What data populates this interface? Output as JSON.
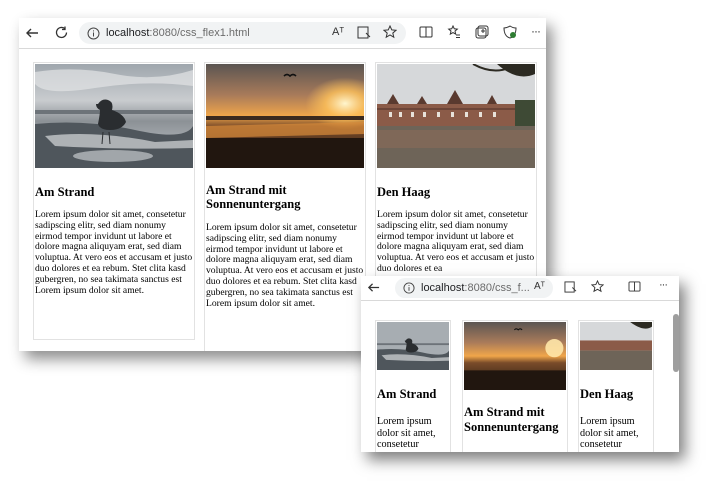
{
  "large_window": {
    "url_host": "localhost",
    "url_rest": ":8080/css_flex1.html",
    "cards": [
      {
        "title": "Am Strand",
        "image": "beach-bird-photo",
        "text": "Lorem ipsum dolor sit amet, consetetur sadipscing elitr, sed diam nonumy eirmod tempor invidunt ut labore et dolore magna aliquyam erat, sed diam voluptua. At vero eos et accusam et justo duo dolores et ea rebum. Stet clita kasd gubergren, no sea takimata sanctus est Lorem ipsum dolor sit amet."
      },
      {
        "title": "Am Strand mit Sonnenuntergang",
        "image": "sunset-beach-photo",
        "text": "Lorem ipsum dolor sit amet, consetetur sadipscing elitr, sed diam nonumy eirmod tempor invidunt ut labore et dolore magna aliquyam erat, sed diam voluptua. At vero eos et accusam et justo duo dolores et ea rebum. Stet clita kasd gubergren, no sea takimata sanctus est Lorem ipsum dolor sit amet."
      },
      {
        "title": "Den Haag",
        "image": "den-haag-photo",
        "text": "Lorem ipsum dolor sit amet, consetetur sadipscing elitr, sed diam nonumy eirmod tempor invidunt ut labore et dolore magna aliquyam erat, sed diam voluptua. At vero eos et accusam et justo duo dolores et ea"
      }
    ]
  },
  "small_window": {
    "url_host": "localhost",
    "url_rest": ":8080/css_f...",
    "cards": [
      {
        "title": "Am Strand",
        "text": "Lorem ipsum dolor sit amet, consetetur"
      },
      {
        "title": "Am Strand mit Sonnenuntergang",
        "text": ""
      },
      {
        "title": "Den Haag",
        "text": "Lorem ipsum dolor sit amet, consetetur"
      }
    ]
  },
  "toolbar_icons": {
    "read_aloud": "Aᵀ",
    "more": "···"
  }
}
